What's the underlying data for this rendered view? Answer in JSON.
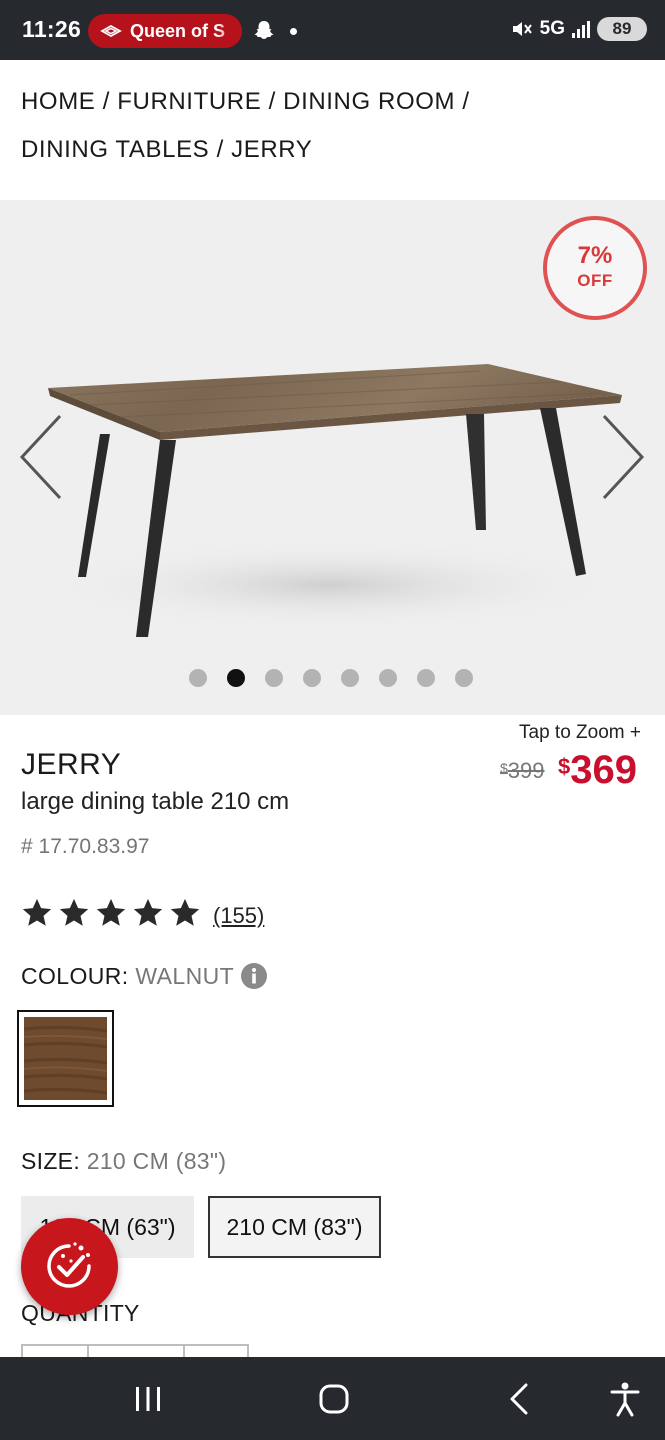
{
  "status_bar": {
    "time": "11:26",
    "notification": "Queen of S",
    "network": "5G",
    "battery": "89"
  },
  "breadcrumb": [
    "HOME",
    "FURNITURE",
    "DINING ROOM",
    "DINING TABLES",
    "JERRY"
  ],
  "breadcrumb_separator": "/",
  "gallery": {
    "badge_line1": "7%",
    "badge_line2": "OFF",
    "image_count": 8,
    "active_index": 1
  },
  "product": {
    "zoom_label": "Tap to Zoom +",
    "name": "JERRY",
    "description": "large dining table 210 cm",
    "sku": "# 17.70.83.97",
    "old_price_currency": "$",
    "old_price": "399",
    "new_price_currency": "$",
    "new_price": "369",
    "rating": 5,
    "review_count": "(155)"
  },
  "colour": {
    "label": "COLOUR:",
    "value": "WALNUT"
  },
  "size": {
    "label": "SIZE:",
    "value": "210 CM (83\")",
    "options": [
      "160 CM (63\")",
      "210 CM (83\")"
    ],
    "selected_index": 1
  },
  "quantity": {
    "label": "QUANTITY"
  },
  "colors": {
    "brand_red": "#c8102e",
    "status_bar": "#26292d",
    "badge_red": "#e05252"
  },
  "icons": {
    "left_arrow": "chevron-left-icon",
    "right_arrow": "chevron-right-icon",
    "info": "info-icon",
    "fab": "checklist-sparkle-icon"
  }
}
